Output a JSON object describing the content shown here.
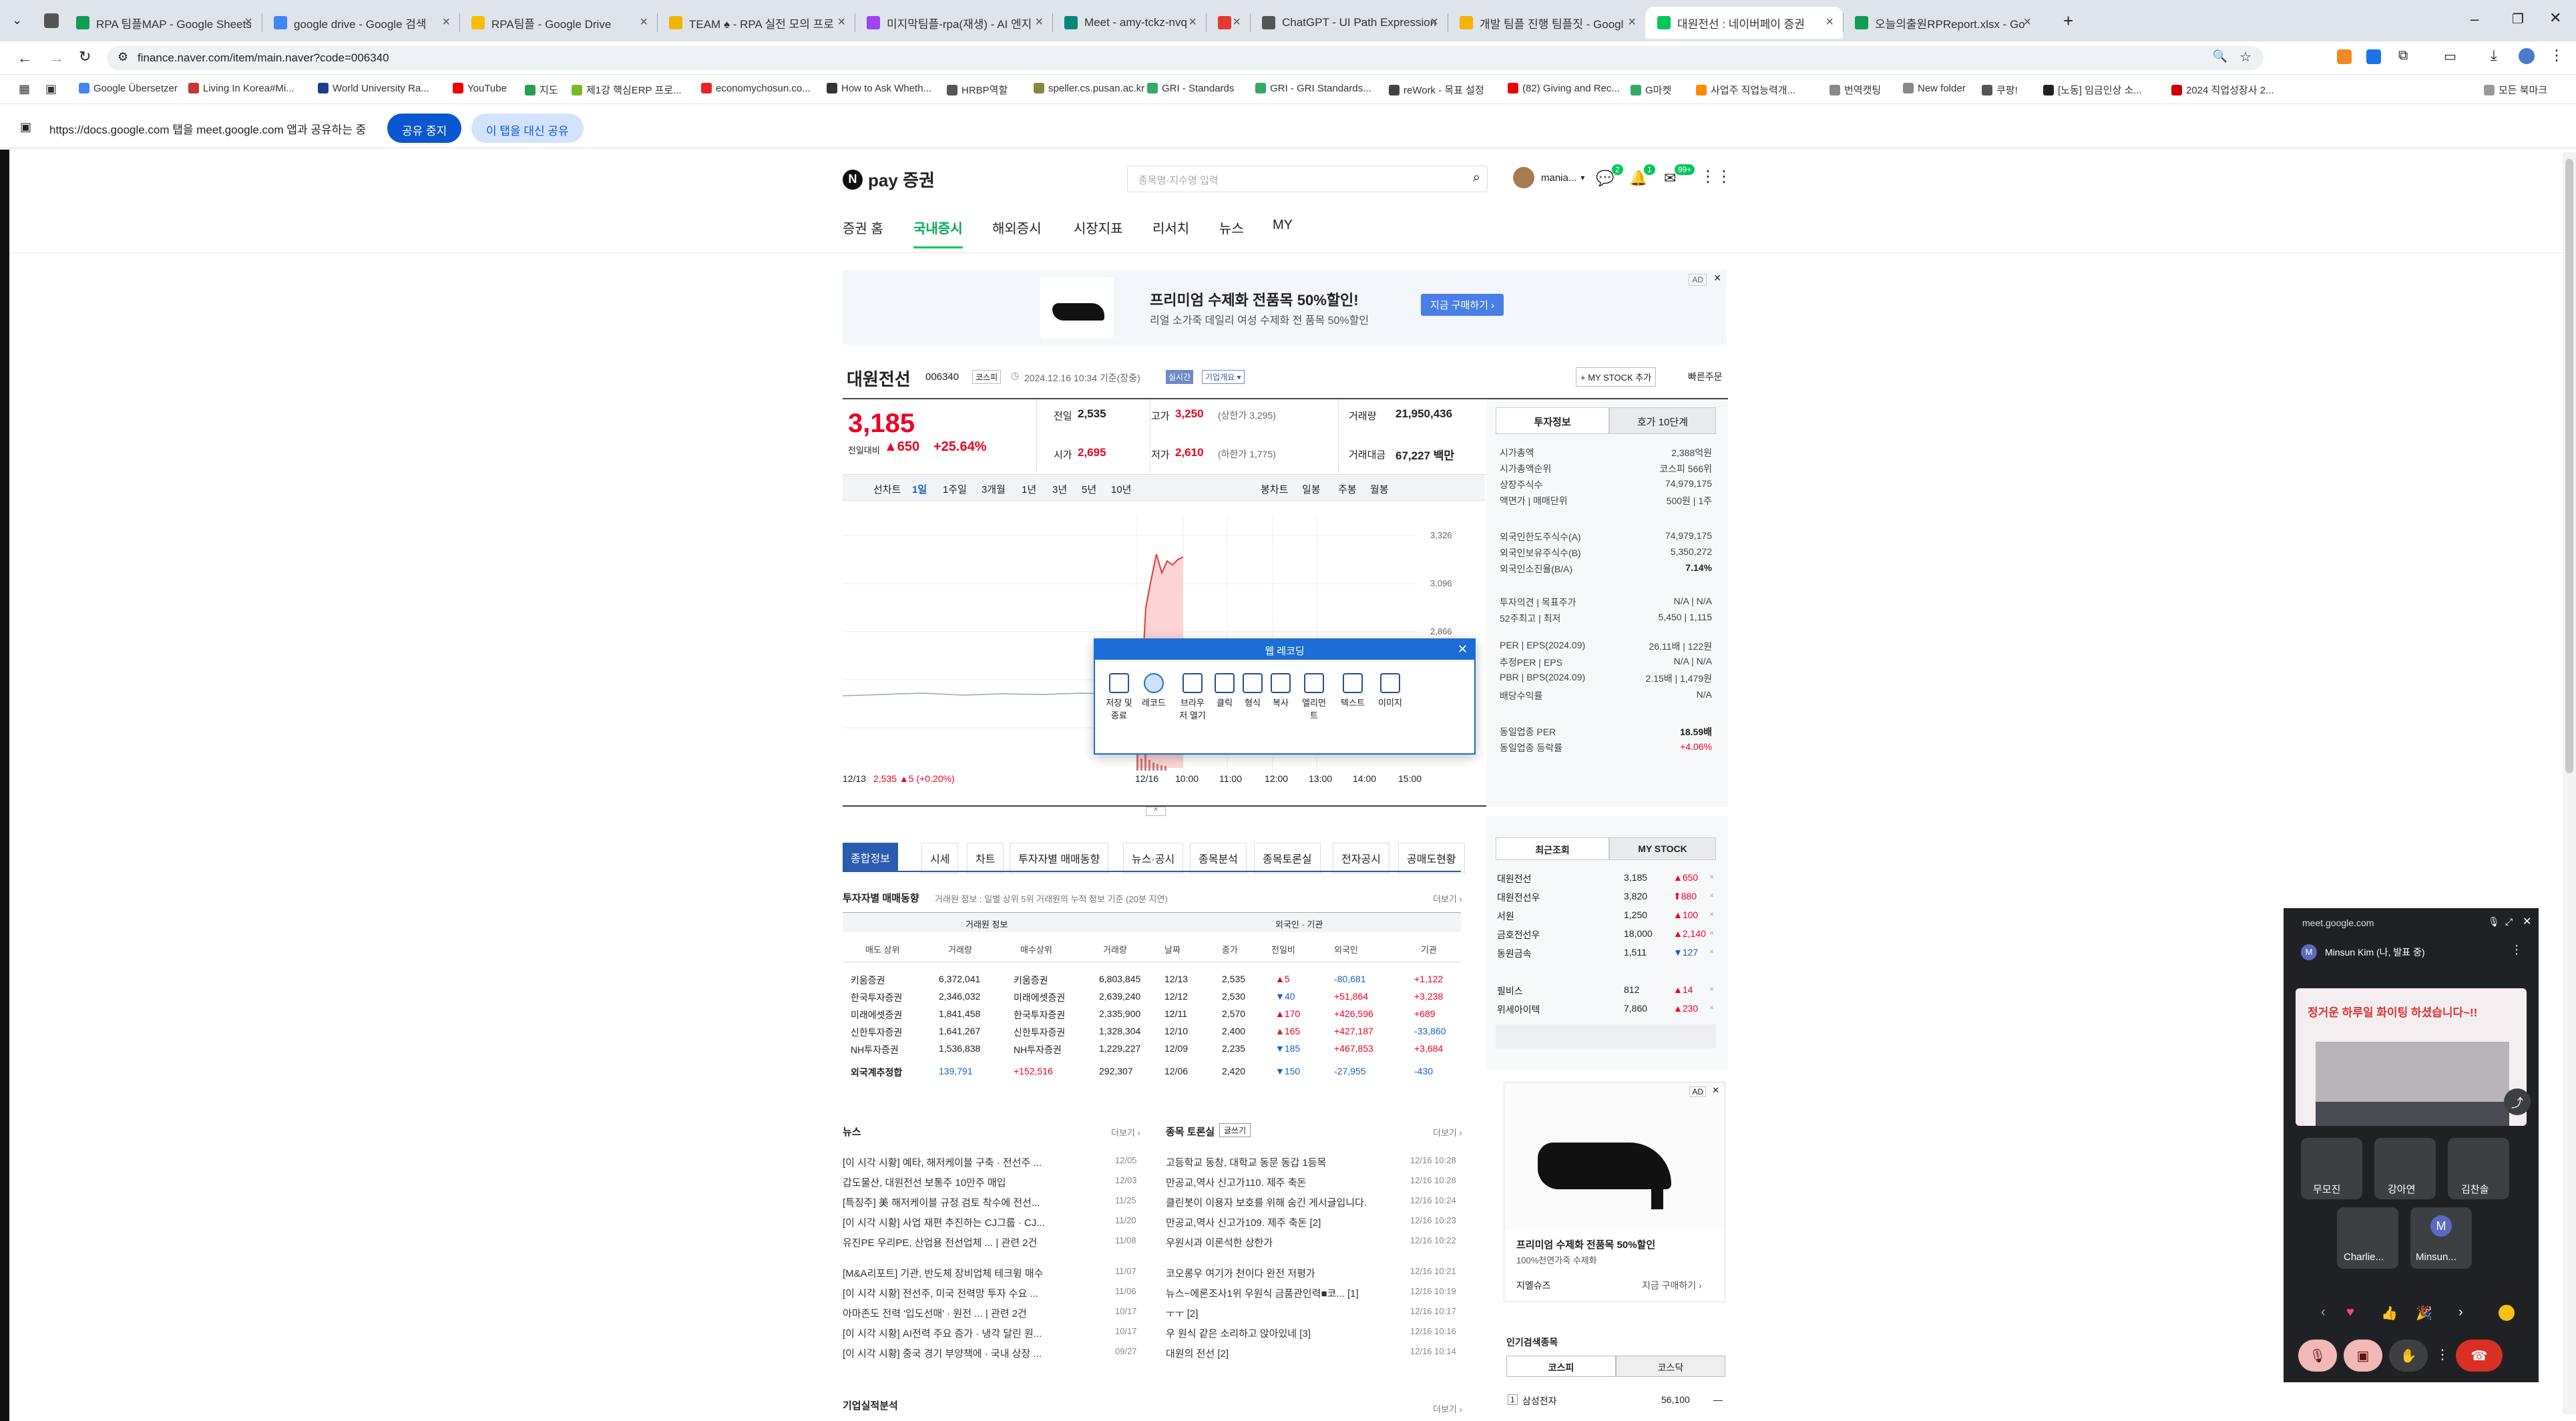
{
  "browser": {
    "tabs": [
      {
        "label": "RPA 팀플MAP - Google Sheets",
        "color": "#0f9d58"
      },
      {
        "label": "google drive - Google 검색",
        "color": "#4285f4"
      },
      {
        "label": "RPA팀플 - Google Drive",
        "color": "#fbbc04"
      },
      {
        "label": "TEAM ♠ - RPA 실전 모의 프로",
        "color": "#f4b400"
      },
      {
        "label": "미지막팀플-rpa(재생) - AI 엔지",
        "color": "#a142f4"
      },
      {
        "label": "Meet - amy-tckz-nvq",
        "color": "#00897b"
      },
      {
        "label": "",
        "color": "#e53935"
      },
      {
        "label": "ChatGPT - UI Path Expression",
        "color": "#555555"
      },
      {
        "label": "개발 팀플 진행 팀플짓 - Googl",
        "color": "#f4b400"
      },
      {
        "label": "대원전선 : 네이버페이 증권",
        "color": "#03c75a"
      },
      {
        "label": "오늘의출원RPReport.xlsx - Go",
        "color": "#0f9d58"
      }
    ],
    "url": "finance.naver.com/item/main.naver?code=006340",
    "bookmarks": [
      "Google Übersetzer",
      "Living In Korea#Mi...",
      "World University Ra...",
      "YouTube",
      "지도",
      "제1강 핵심ERP 프로...",
      "economychosun.co...",
      "How to Ask Wheth...",
      "HRBP역할",
      "speller.cs.pusan.ac.kr",
      "GRI - Standards",
      "GRI - GRI Standards...",
      "reWork - 목표 설정",
      "(82) Giving and Rec...",
      "G마켓",
      "사업주 직업능력개...",
      "번역캣팅",
      "New folder",
      "쿠팡!",
      "[노동] 임금인상 소...",
      "2024 직업성장사 2..."
    ],
    "other_bookmarks": "모든 북마크",
    "share_notice": "https://docs.google.com 탭을 meet.google.com 앱과 공유하는 중",
    "stop_share": "공유 중지",
    "share_this": "이 탭을 대신 공유"
  },
  "site": {
    "logo": "pay 증권",
    "search_placeholder": "종목명·지수명 입력",
    "user": "mania...",
    "badges": [
      "2",
      "1",
      "99+"
    ],
    "nav": [
      "증권 홈",
      "국내증시",
      "해외증시",
      "시장지표",
      "리서치",
      "뉴스",
      "MY"
    ],
    "ad": {
      "tag": "AD",
      "title": "프리미엄 수제화 전품목 50%할인!",
      "sub": "리얼 소가죽 데일리 여성 수제화 전 품목 50%할인",
      "btn": "지금 구매하기 ›"
    },
    "stock": {
      "name": "대원전선",
      "code": "006340",
      "market": "코스피",
      "date": "2024.12.16 10:34 기준(장중)",
      "tag1": "실시간",
      "tag2": "기업개요 ▾",
      "mystock": "+ MY STOCK 추가",
      "quick": "빠른주문",
      "price": "3,185",
      "change_label": "전일대비",
      "change": "▲650",
      "pct": "+25.64%",
      "prev_label": "전일",
      "prev": "2,535",
      "high_label": "고가",
      "high": "3,250",
      "upper": "(상한가 3,295)",
      "vol_label": "거래량",
      "vol": "21,950,436",
      "open_label": "시가",
      "open": "2,695",
      "low_label": "저가",
      "low": "2,610",
      "lower": "(하한가 1,775)",
      "amt_label": "거래대금",
      "amt": "67,227 백만"
    },
    "periods": [
      "선차트",
      "1일",
      "1주일",
      "3개월",
      "1년",
      "3년",
      "5년",
      "10년"
    ],
    "candle": [
      "봉차트",
      "일봉",
      "주봉",
      "월봉"
    ],
    "chart_axis": [
      "3,326",
      "3,096",
      "2,866"
    ],
    "chart_x": [
      "12/13",
      "2,535 ▲5 (+0.20%)",
      "12/16",
      "10:00",
      "11:00",
      "12:00",
      "13:00",
      "14:00",
      "15:00"
    ],
    "side_tabs": [
      "투자정보",
      "호가 10단계"
    ],
    "side": [
      [
        "시가총액",
        "2,388억원"
      ],
      [
        "시가총액순위",
        "코스피 566위"
      ],
      [
        "상장주식수",
        "74,979,175"
      ],
      [
        "액면가 | 매매단위",
        "500원 | 1주"
      ],
      [
        "외국인한도주식수(A)",
        "74,979,175"
      ],
      [
        "외국인보유주식수(B)",
        "5,350,272"
      ],
      [
        "외국인소진율(B/A)",
        "7.14%"
      ],
      [
        "투자의견 | 목표주가",
        "N/A | N/A"
      ],
      [
        "52주최고 | 최저",
        "5,450 | 1,115"
      ],
      [
        "PER | EPS(2024.09)",
        "26.11배 | 122원"
      ],
      [
        "추정PER | EPS",
        "N/A | N/A"
      ],
      [
        "PBR | BPS(2024.09)",
        "2.15배 | 1,479원"
      ],
      [
        "배당수익률",
        "N/A"
      ],
      [
        "동일업종 PER",
        "18.59배"
      ],
      [
        "동일업종 등락률",
        "+4.06%"
      ]
    ],
    "tabs2": [
      "종합정보",
      "시세",
      "차트",
      "투자자별 매매동향",
      "뉴스·공시",
      "종목분석",
      "종목토론실",
      "전자공시",
      "공매도현황"
    ],
    "trade_title": "투자자별 매매동향",
    "trade_sub": "거래원 정보 : 일별 상위 5위 거래원의 누적 정보 기준 (20분 지연)",
    "more": "더보기 ›",
    "trade_head": [
      "거래원 정보",
      "외국인 · 기관"
    ],
    "trade_cols": [
      "매도 상위",
      "거래량",
      "매수상위",
      "거래량",
      "날짜",
      "종가",
      "전일비",
      "외국인",
      "기관"
    ],
    "trade_rows": [
      [
        "키움증권",
        "6,372,041",
        "키움증권",
        "6,803,845",
        "12/13",
        "2,535",
        "▲5",
        "-80,681",
        "+1,122"
      ],
      [
        "한국투자증권",
        "2,346,032",
        "미래에셋증권",
        "2,639,240",
        "12/12",
        "2,530",
        "▼40",
        "+51,864",
        "+3,238"
      ],
      [
        "미래에셋증권",
        "1,841,458",
        "한국투자증권",
        "2,335,900",
        "12/11",
        "2,570",
        "▲170",
        "+426,596",
        "+689"
      ],
      [
        "신한투자증권",
        "1,641,267",
        "신한투자증권",
        "1,328,304",
        "12/10",
        "2,400",
        "▲165",
        "+427,187",
        "-33,860"
      ],
      [
        "NH투자증권",
        "1,536,838",
        "NH투자증권",
        "1,229,227",
        "12/09",
        "2,235",
        "▼185",
        "+467,853",
        "+3,684"
      ],
      [
        "외국계추정합",
        "139,791",
        "+152,516",
        "292,307",
        "12/06",
        "2,420",
        "▼150",
        "-27,955",
        "-430"
      ]
    ],
    "news_title": "뉴스",
    "news": [
      [
        "[이 시각 시황] 예타, 해저케이블 구축 · 전선주 ...",
        "12/05"
      ],
      [
        "갑도물산, 대원전선 보통주 10만주 매입",
        "12/03"
      ],
      [
        "[특징주] 美 해저케이블 규정 검토 착수에 전선...",
        "11/25"
      ],
      [
        "[이 시각 시황] 사업 재편 추진하는 CJ그룹 · CJ...",
        "11/20"
      ],
      [
        "유진PE 우리PE, 산업용 전선업체 ... | 관련 2건",
        "11/08"
      ],
      [
        "[M&A리포트] 기관, 반도체 장비업체 테크윙 매수",
        "11/07"
      ],
      [
        "[이 시각 시황] 전선주, 미국 전력망 투자 수요 ...",
        "11/06"
      ],
      [
        "아마존도 전력 '입도선매' · 원전 ... | 관련 2건",
        "10/17"
      ],
      [
        "[이 시각 시황] AI전력 주요 증가 · 냉각 달린 원...",
        "10/17"
      ],
      [
        "[이 시각 시황] 중국 경기 부양책에 · 국내 상장 ...",
        "09/27"
      ]
    ],
    "board_title": "종목 토론실",
    "board_btn": "글쓰기",
    "board": [
      [
        "고등학교 동창, 대학교 동문 동갑 1등목",
        "12/16 10:28"
      ],
      [
        "만공교,역사 신고가110. 제주 축돈",
        "12/16 10:28"
      ],
      [
        "클린봇이 이용자 보호를 위해 숨긴 게시글입니다.",
        "12/16 10:24"
      ],
      [
        "만공교,역사 신고가109. 제주 축돈 [2]",
        "12/16 10:23"
      ],
      [
        "우원시과 이론석한 상한가",
        "12/16 10:22"
      ],
      [
        "코오롱우 여기가 천이다 완전 저평가",
        "12/16 10:21"
      ],
      [
        "뉴스~에론조사1위 우원식 금품관인력■코... [1]",
        "12/16 10:19"
      ],
      [
        "ㅜㅜ [2]",
        "12/16 10:17"
      ],
      [
        "우 원식 같은 소리하고 앉아있네 [3]",
        "12/16 10:16"
      ],
      [
        "대원의 전선 [2]",
        "12/16 10:14"
      ]
    ],
    "analysis_title": "기업실적분석",
    "recent_tabs": [
      "최근조회",
      "MY STOCK"
    ],
    "recent": [
      [
        "대원전선",
        "3,185",
        "▲650"
      ],
      [
        "대원전선우",
        "3,820",
        "⬆880"
      ],
      [
        "서원",
        "1,250",
        "▲100"
      ],
      [
        "금호전선우",
        "18,000",
        "▲2,140"
      ],
      [
        "동원금속",
        "1,511",
        "▼127"
      ],
      [
        "필비스",
        "812",
        "▲14"
      ],
      [
        "위세아이텍",
        "7,860",
        "▲230"
      ]
    ],
    "ad2": {
      "tag": "AD",
      "title": "프리미엄 수제화 전품목 50%할인",
      "sub": "100%천연가죽 수제화",
      "brand": "지엘슈즈",
      "cta": "지금 구매하기 ›"
    },
    "popular_title": "인기검색종목",
    "popular_tabs": [
      "코스피",
      "코스닥"
    ],
    "popular_first": [
      "1",
      "삼성전자",
      "56,100",
      "—"
    ]
  },
  "popup": {
    "title": "웹 레코딩",
    "tools": [
      "저장 및 종료",
      "레코드",
      "브라우저 열기",
      "클릭",
      "형식",
      "복사",
      "엘리먼트",
      "텍스트",
      "이미지"
    ]
  },
  "meet": {
    "host": "meet.google.com",
    "presenter": "Minsun Kim (나, 발표 중)",
    "slide": "정거운 하루일 화이팅 하셨습니다~!!",
    "participants": [
      "무모진",
      "강아연",
      "김찬솔",
      "Charlie...",
      "Minsun..."
    ],
    "avatar_letter": "M"
  }
}
